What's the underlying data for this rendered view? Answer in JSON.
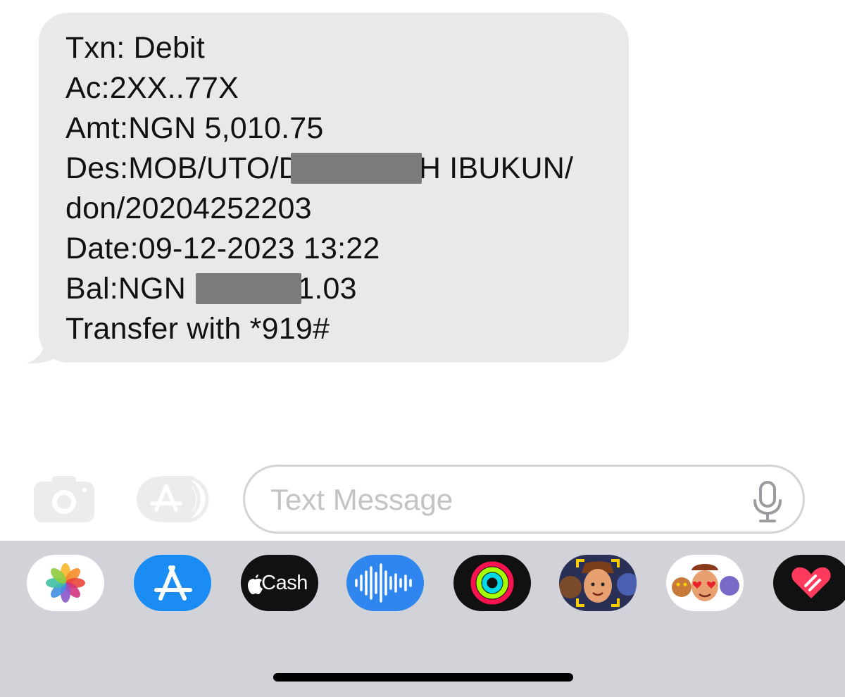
{
  "message": {
    "lines": [
      {
        "text": "Txn: Debit"
      },
      {
        "text": "Ac:2XX..77X"
      },
      {
        "text": "Amt:NGN 5,010.75"
      },
      {
        "prefix": "Des:MOB/UTO/D",
        "suffix": "H IBUKUN/"
      },
      {
        "text": "don/20204252203"
      },
      {
        "text": "Date:09-12-2023 13:22"
      },
      {
        "prefix": "Bal:NGN ",
        "suffix": "1.03"
      },
      {
        "text": "Transfer with *919#"
      }
    ],
    "bubble_color": "#e9e9eb"
  },
  "composer": {
    "placeholder": "Text Message",
    "camera_icon": "camera-icon",
    "apps_icon": "app-store-icon",
    "mic_icon": "microphone-icon"
  },
  "app_drawer": {
    "apps": [
      {
        "name": "photos",
        "icon": "photos-icon"
      },
      {
        "name": "app-store",
        "icon": "app-store-icon"
      },
      {
        "name": "apple-cash",
        "label": "Cash",
        "icon": "apple-logo-icon"
      },
      {
        "name": "audio-message",
        "icon": "waveform-icon"
      },
      {
        "name": "fitness",
        "icon": "activity-rings-icon"
      },
      {
        "name": "memoji",
        "icon": "memoji-icon"
      },
      {
        "name": "memoji-stickers",
        "icon": "memoji-stickers-icon"
      },
      {
        "name": "digital-touch",
        "icon": "heart-icon"
      }
    ],
    "background": "#d1d3d9"
  }
}
